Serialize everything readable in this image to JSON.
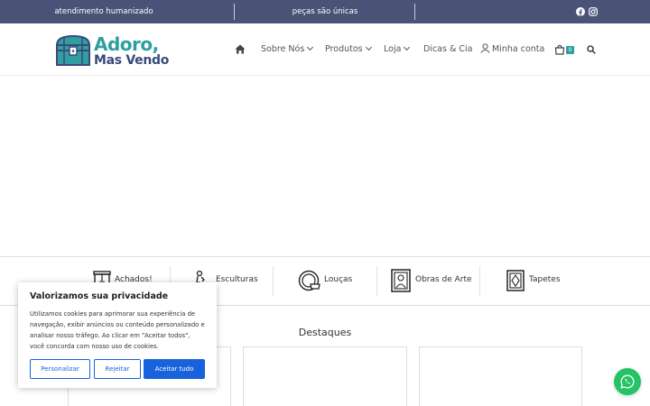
{
  "topbar": {
    "left_text": "atendimento humanizado",
    "middle_text": "peças são únicas",
    "social_icons": [
      "facebook-icon",
      "instagram-icon"
    ]
  },
  "header": {
    "logo": {
      "line1": "Adoro,",
      "line2": "Mas Vendo"
    },
    "nav": {
      "sobre": "Sobre Nós",
      "produtos": "Produtos",
      "loja": "Loja",
      "dicas": "Dicas & Cia",
      "conta": "Minha conta",
      "cart_count": "0"
    }
  },
  "categories": [
    {
      "label": "Achados!",
      "icon": "cabinet-icon"
    },
    {
      "label": "Esculturas",
      "icon": "sculpture-icon"
    },
    {
      "label": "Louças",
      "icon": "plate-icon"
    },
    {
      "label": "Obras de Arte",
      "icon": "portrait-frame-icon"
    },
    {
      "label": "Tapetes",
      "icon": "rug-icon"
    }
  ],
  "section": {
    "title": "Destaques"
  },
  "cookie": {
    "title": "Valorizamos sua privacidade",
    "text": "Utilizamos cookies para aprimorar sua experiência de navegação, exibir anúncios ou conteúdo personalizado e analisar nosso tráfego. Ao clicar em \"Aceitar todos\", você concorda com nosso uso de cookies.",
    "customize": "Personalizar",
    "reject": "Rejeitar",
    "accept": "Aceitar tudo"
  },
  "colors": {
    "topbar": "#4a5277",
    "brand_teal": "#2f9fa0",
    "brand_navy": "#3a4a7a",
    "cookie_blue": "#1863dc",
    "whatsapp_green": "#25c364"
  }
}
